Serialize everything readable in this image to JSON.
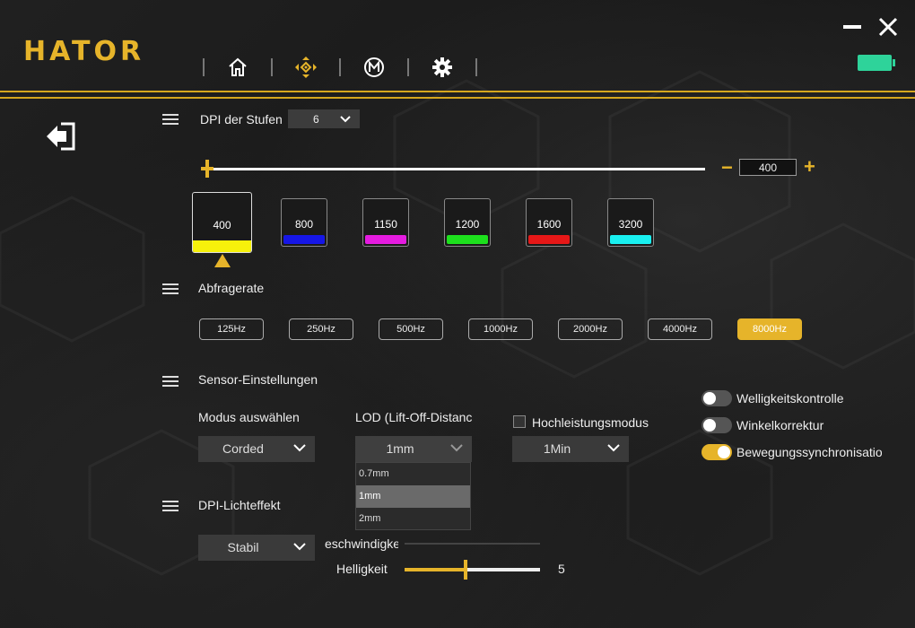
{
  "app": {
    "logo": "HATOR"
  },
  "nav": {
    "items": [
      "home-icon",
      "crosshair-icon",
      "macro-icon",
      "gear-icon"
    ],
    "active": 1
  },
  "window": {
    "battery_color": "#2ed39a"
  },
  "dpi": {
    "section_title": "DPI der Stufen",
    "stages_value": "6",
    "current_value": "400",
    "minus": "−",
    "plus": "+",
    "stages": [
      {
        "label": "400",
        "color": "#f6f10b"
      },
      {
        "label": "800",
        "color": "#1616e6"
      },
      {
        "label": "1150",
        "color": "#e51be0"
      },
      {
        "label": "1200",
        "color": "#1de01d"
      },
      {
        "label": "1600",
        "color": "#e61717"
      },
      {
        "label": "3200",
        "color": "#19f0f0"
      }
    ],
    "selected_index": 0
  },
  "polling": {
    "section_title": "Abfragerate",
    "rates": [
      "125Hz",
      "250Hz",
      "500Hz",
      "1000Hz",
      "2000Hz",
      "4000Hz",
      "8000Hz"
    ],
    "selected_index": 6
  },
  "sensor": {
    "section_title": "Sensor-Einstellungen",
    "mode_label": "Modus auswählen",
    "mode_value": "Corded",
    "lod_label": "LOD (Lift-Off-Distanc",
    "lod_value": "1mm",
    "lod_options": [
      "0.7mm",
      "1mm",
      "2mm"
    ],
    "lod_selected": 1,
    "highperf_label": "Hochleistungsmodus",
    "highperf_value": "1Min",
    "toggles": [
      {
        "label": "Welligkeitskontrolle",
        "on": false
      },
      {
        "label": "Winkelkorrektur",
        "on": false
      },
      {
        "label": "Bewegungssynchronisatio",
        "on": true
      }
    ]
  },
  "light": {
    "section_title": "DPI-Lichteffekt",
    "effect_value": "Stabil",
    "speed_label": "eschwindigke",
    "brightness_label": "Helligkeit",
    "brightness_value": "5",
    "brightness_fraction": 0.45
  },
  "colors": {
    "accent": "#e6b42a"
  }
}
